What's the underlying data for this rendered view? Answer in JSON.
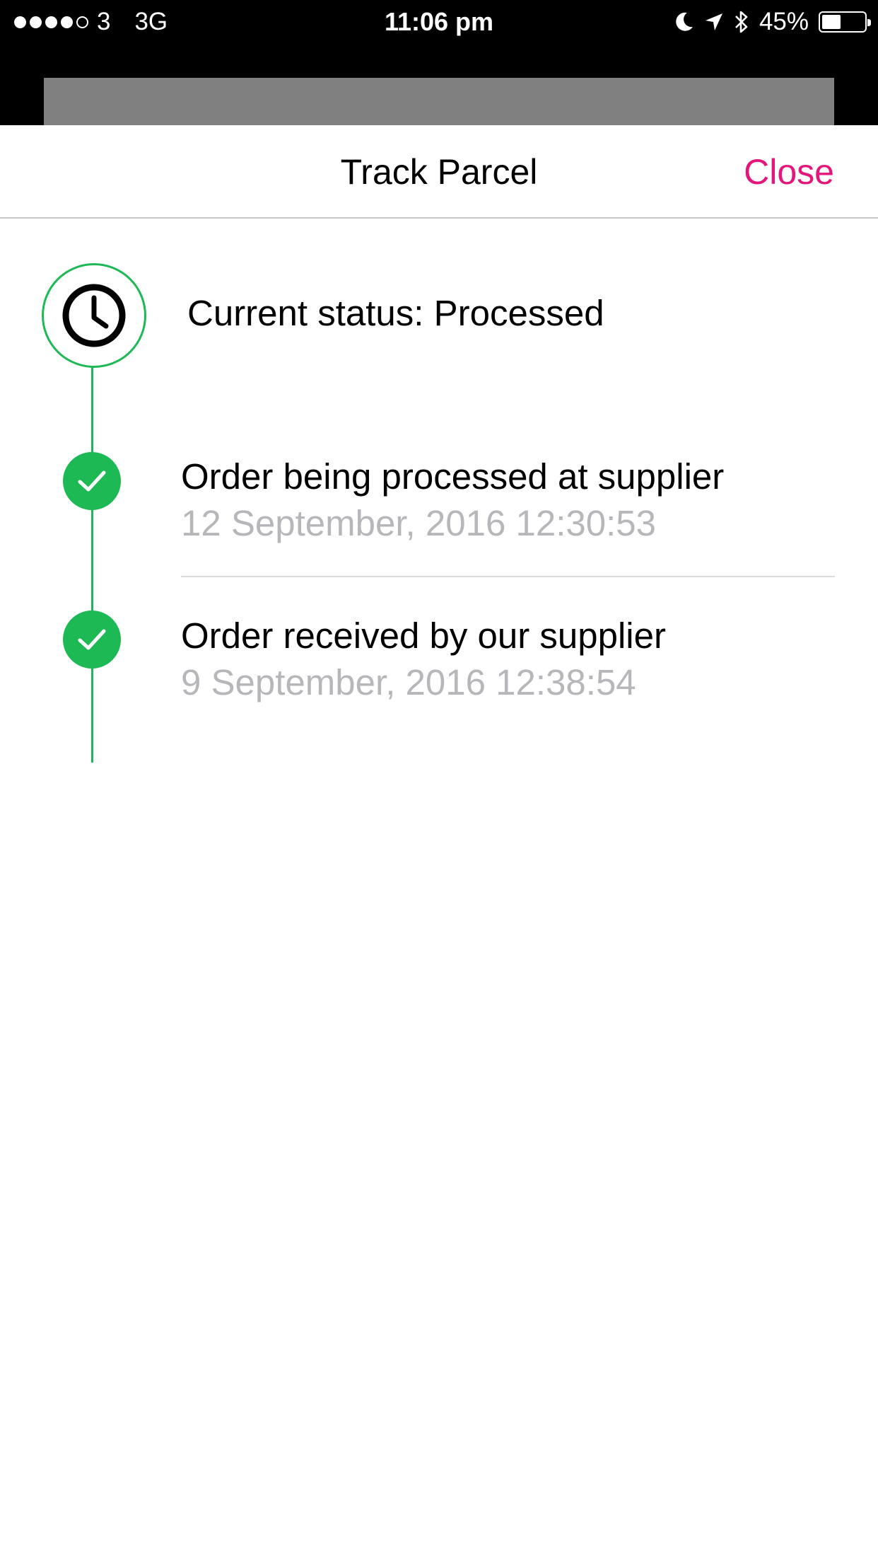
{
  "status_bar": {
    "carrier": "3",
    "network": "3G",
    "time": "11:06 pm",
    "battery_percent_label": "45%",
    "battery_level": 0.45,
    "signal_bars_filled": 4,
    "signal_bars_total": 5,
    "icons": [
      "moon-icon",
      "location-arrow-icon",
      "bluetooth-icon",
      "battery-icon"
    ]
  },
  "nav": {
    "title": "Track Parcel",
    "close_label": "Close"
  },
  "tracking": {
    "current_status": "Current status: Processed",
    "current_icon": "clock-icon",
    "events": [
      {
        "title": "Order being processed at supplier",
        "date": "12 September, 2016 12:30:53",
        "icon": "check-icon"
      },
      {
        "title": "Order received by our supplier",
        "date": "9 September, 2016 12:38:54",
        "icon": "check-icon"
      }
    ]
  },
  "colors": {
    "accent": "#e4157b",
    "success": "#1db954",
    "secondary_text": "#b7b7bb"
  }
}
